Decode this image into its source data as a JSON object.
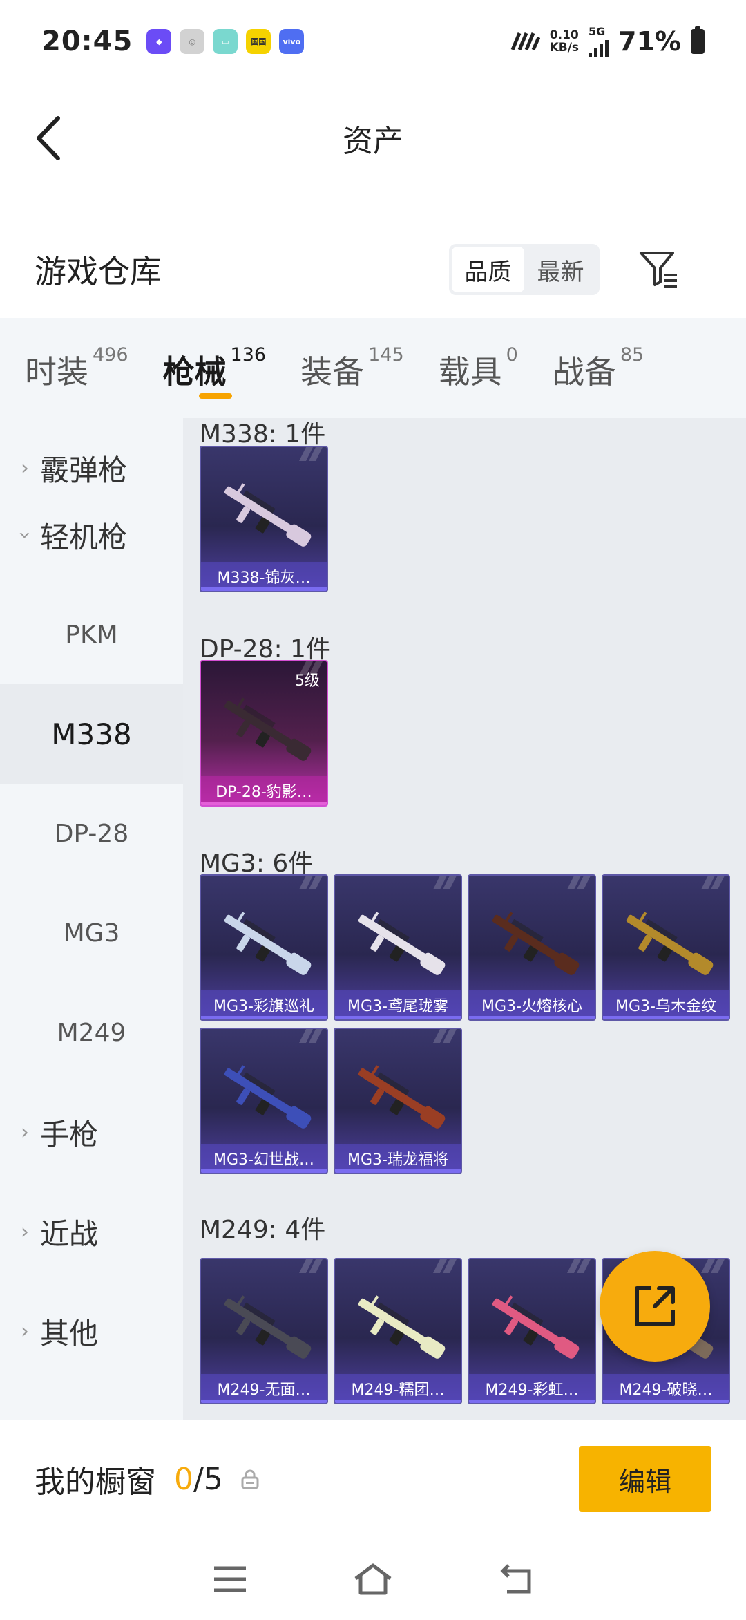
{
  "status_bar": {
    "time": "20:45",
    "app_icons": [
      {
        "name": "purple-app-icon",
        "color": "#6b4cf6",
        "label": ""
      },
      {
        "name": "gray-app-icon",
        "color": "#c8c8c8",
        "label": ""
      },
      {
        "name": "teal-app-icon",
        "color": "#7ad8cf",
        "label": ""
      },
      {
        "name": "yellow-app-icon",
        "color": "#f5d200",
        "label": "国国"
      },
      {
        "name": "vivo-app-icon",
        "color": "#4f6ef2",
        "label": "vivo"
      }
    ],
    "net_speed_value": "0.10",
    "net_speed_unit": "KB/s",
    "network_type": "5G",
    "battery_percent": "71%"
  },
  "header": {
    "title": "资产"
  },
  "warehouse": {
    "title": "游戏仓库",
    "sort_options": [
      {
        "label": "品质",
        "active": true
      },
      {
        "label": "最新",
        "active": false
      }
    ]
  },
  "tabs": [
    {
      "label": "时装",
      "count": "496",
      "active": false
    },
    {
      "label": "枪械",
      "count": "136",
      "active": true
    },
    {
      "label": "装备",
      "count": "145",
      "active": false
    },
    {
      "label": "载具",
      "count": "0",
      "active": false
    },
    {
      "label": "战备",
      "count": "85",
      "active": false
    }
  ],
  "side_nav": [
    {
      "label": "霰弹枪",
      "type": "category",
      "expanded": false
    },
    {
      "label": "轻机枪",
      "type": "category",
      "expanded": true
    },
    {
      "label": "PKM",
      "type": "sub",
      "active": false
    },
    {
      "label": "M338",
      "type": "sub",
      "active": true
    },
    {
      "label": "DP-28",
      "type": "sub",
      "active": false
    },
    {
      "label": "MG3",
      "type": "sub",
      "active": false
    },
    {
      "label": "M249",
      "type": "sub",
      "active": false
    },
    {
      "label": "手枪",
      "type": "category",
      "expanded": false
    },
    {
      "label": "近战",
      "type": "category",
      "expanded": false
    },
    {
      "label": "其他",
      "type": "category",
      "expanded": false
    }
  ],
  "groups": [
    {
      "title": "M338: 1件",
      "items": [
        {
          "name": "M338-锦灰…",
          "rarity": "blue",
          "gun_color": "#d8c9de"
        }
      ]
    },
    {
      "title": "DP-28: 1件",
      "items": [
        {
          "name": "DP-28-豹影…",
          "rarity": "purple",
          "level": "5级",
          "gun_color": "#3a2a33"
        }
      ]
    },
    {
      "title": "MG3: 6件",
      "items": [
        {
          "name": "MG3-彩旗巡礼",
          "rarity": "blue",
          "gun_color": "#c9d6ea"
        },
        {
          "name": "MG3-鸢尾珑雾",
          "rarity": "blue",
          "gun_color": "#e6e2ea"
        },
        {
          "name": "MG3-火熔核心",
          "rarity": "blue",
          "gun_color": "#5a2c1e"
        },
        {
          "name": "MG3-乌木金纹",
          "rarity": "blue",
          "gun_color": "#b38a2b"
        },
        {
          "name": "MG3-幻世战…",
          "rarity": "blue",
          "gun_color": "#3d4fb8"
        },
        {
          "name": "MG3-瑞龙福将",
          "rarity": "blue",
          "gun_color": "#9a3e24"
        }
      ]
    },
    {
      "title": "M249: 4件",
      "items": [
        {
          "name": "M249-无面…",
          "rarity": "blue",
          "gun_color": "#4a4a55"
        },
        {
          "name": "M249-糯团…",
          "rarity": "blue",
          "gun_color": "#e8eac4"
        },
        {
          "name": "M249-彩虹…",
          "rarity": "blue",
          "gun_color": "#e05a82"
        },
        {
          "name": "M249-破晓…",
          "rarity": "blue",
          "gun_color": "#7c6a5a"
        }
      ]
    }
  ],
  "showcase": {
    "label": "我的橱窗",
    "current": "0",
    "total": "/5",
    "edit_label": "编辑"
  },
  "colors": {
    "accent": "#f7ab0d",
    "card_blue_border": "#5e58a7",
    "card_purple_border": "#d34ed2"
  }
}
